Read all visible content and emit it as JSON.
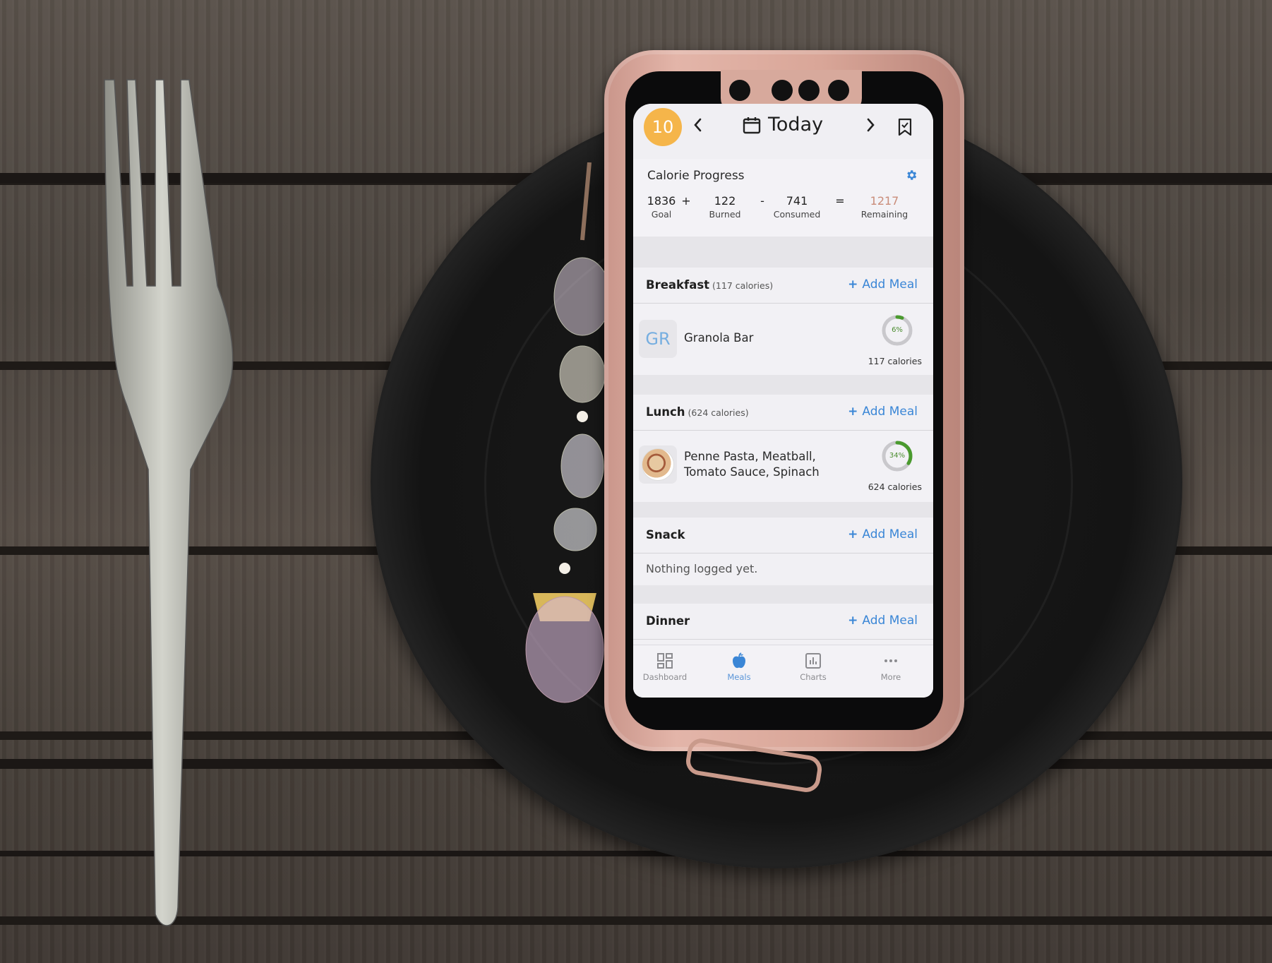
{
  "header": {
    "day_badge": "10",
    "title": "Today",
    "prev_icon": "chevron-left-icon",
    "next_icon": "chevron-right-icon",
    "calendar_icon": "calendar-icon",
    "bookmark_icon": "bookmark-check-icon"
  },
  "calorie_progress": {
    "title": "Calorie Progress",
    "settings_icon": "gear-icon",
    "goal": {
      "value": "1836",
      "label": "Goal"
    },
    "op1": "+",
    "burned": {
      "value": "122",
      "label": "Burned"
    },
    "op2": "-",
    "consumed": {
      "value": "741",
      "label": "Consumed"
    },
    "op3": "=",
    "remaining": {
      "value": "1217",
      "label": "Remaining"
    }
  },
  "meals": {
    "add_label": "Add Meal",
    "breakfast": {
      "name": "Breakfast",
      "calories_note": "(117 calories)",
      "items": [
        {
          "thumb_text": "GR",
          "title": "Granola Bar",
          "percent_label": "6%",
          "percent": 6,
          "calories": "117 calories"
        }
      ]
    },
    "lunch": {
      "name": "Lunch",
      "calories_note": "(624 calories)",
      "items": [
        {
          "title_line1": "Penne Pasta, Meatball,",
          "title_line2": "Tomato Sauce, Spinach",
          "percent_label": "34%",
          "percent": 34,
          "calories": "624 calories"
        }
      ]
    },
    "snack": {
      "name": "Snack",
      "empty_text": "Nothing logged yet."
    },
    "dinner": {
      "name": "Dinner"
    }
  },
  "tabbar": {
    "tabs": [
      {
        "label": "Dashboard",
        "icon": "dashboard-icon",
        "active": false
      },
      {
        "label": "Meals",
        "icon": "apple-icon",
        "active": true
      },
      {
        "label": "Charts",
        "icon": "bar-chart-icon",
        "active": false
      },
      {
        "label": "More",
        "icon": "more-icon",
        "active": false
      }
    ]
  },
  "colors": {
    "accent": "#3a86d6",
    "badge": "#f5b54a",
    "remaining": "#c98c79",
    "progress_ring": "#4a9a2e"
  }
}
